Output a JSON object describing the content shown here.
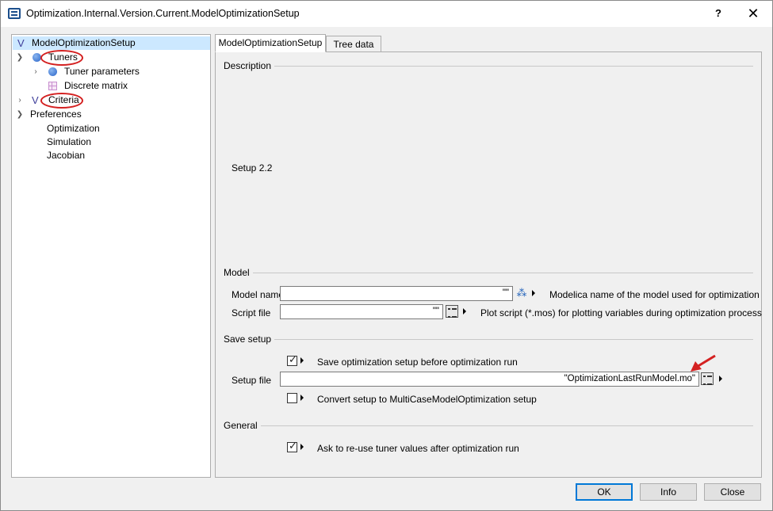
{
  "window": {
    "title": "Optimization.Internal.Version.Current.ModelOptimizationSetup",
    "help_label": "?",
    "close_label": "✕"
  },
  "tree": {
    "items": [
      {
        "label": "ModelOptimizationSetup",
        "icon": "model-v-icon",
        "expander": "",
        "selected": true
      },
      {
        "label": "Tuners",
        "icon": "tuner-dot-icon",
        "expander": "expanded"
      },
      {
        "label": "Tuner parameters",
        "icon": "tuner-dot-icon",
        "expander": "collapsed"
      },
      {
        "label": "Discrete matrix",
        "icon": "matrix-icon",
        "expander": ""
      },
      {
        "label": "Criteria",
        "icon": "criteria-icon",
        "expander": "collapsed"
      },
      {
        "label": "Preferences",
        "icon": "",
        "expander": "expanded"
      },
      {
        "label": "Optimization",
        "icon": "",
        "expander": ""
      },
      {
        "label": "Simulation",
        "icon": "",
        "expander": ""
      },
      {
        "label": "Jacobian",
        "icon": "",
        "expander": ""
      }
    ]
  },
  "tabs": [
    {
      "label": "ModelOptimizationSetup",
      "active": true
    },
    {
      "label": "Tree data",
      "active": false
    }
  ],
  "description": {
    "header": "Description",
    "text": "Setup 2.2"
  },
  "model": {
    "header": "Model",
    "model_name_label": "Model name",
    "model_name_value": "\"\"",
    "model_name_desc": "Modelica name of the model used for optimization",
    "script_file_label": "Script file",
    "script_file_value": "\"\"",
    "script_file_desc": "Plot script (*.mos) for plotting variables during optimization process"
  },
  "save_setup": {
    "header": "Save setup",
    "save_before_run_label": "Save optimization setup before optimization run",
    "save_before_run_checked": true,
    "setup_file_label": "Setup file",
    "setup_file_value": "\"OptimizationLastRunModel.mo\"",
    "convert_label": "Convert setup to MultiCaseModelOptimization setup",
    "convert_checked": false
  },
  "general": {
    "header": "General",
    "reuse_tuners_label": "Ask to re-use tuner values after optimization run",
    "reuse_tuners_checked": true
  },
  "buttons": {
    "ok": "OK",
    "info": "Info",
    "close": "Close"
  },
  "colors": {
    "annotation_red": "#d42121",
    "selection": "#cce8ff",
    "default_button_border": "#0078d7"
  }
}
